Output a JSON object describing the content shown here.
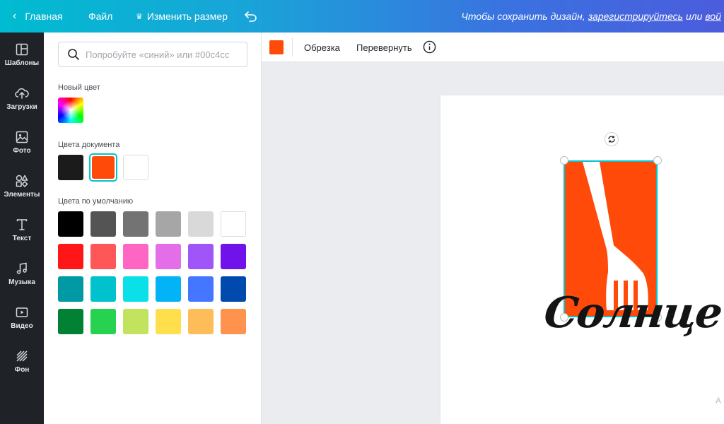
{
  "topbar": {
    "back_label": "Главная",
    "file_label": "Файл",
    "resize_label": "Изменить размер",
    "save_prefix": "Чтобы сохранить дизайн,",
    "save_link_register": "зарегистрируйтесь",
    "save_mid": "или",
    "save_link_login": "вой"
  },
  "rail": {
    "items": [
      {
        "label": "Шаблоны",
        "icon": "templates-icon"
      },
      {
        "label": "Загрузки",
        "icon": "upload-icon"
      },
      {
        "label": "Фото",
        "icon": "photo-icon"
      },
      {
        "label": "Элементы",
        "icon": "elements-icon"
      },
      {
        "label": "Текст",
        "icon": "text-icon"
      },
      {
        "label": "Музыка",
        "icon": "music-icon"
      },
      {
        "label": "Видео",
        "icon": "video-icon"
      },
      {
        "label": "Фон",
        "icon": "background-icon"
      }
    ]
  },
  "panel": {
    "search_placeholder": "Попробуйте «синий» или #00c4cc",
    "new_color_label": "Новый цвет",
    "document_colors_label": "Цвета документа",
    "document_colors": [
      "#1b1b1b",
      "#ff4a0a",
      "#ffffff"
    ],
    "selected_document_color": 1,
    "default_colors_label": "Цвета по умолчанию",
    "default_colors": [
      [
        "#000000",
        "#545454",
        "#737373",
        "#a6a6a6",
        "#d9d9d9",
        "#ffffff"
      ],
      [
        "#ff1616",
        "#ff5757",
        "#ff66c4",
        "#e36ee8",
        "#9f55f7",
        "#7013ea"
      ],
      [
        "#019aa4",
        "#00c2cc",
        "#0ae0e8",
        "#02b3f6",
        "#4576ff",
        "#004aad"
      ],
      [
        "#008133",
        "#26d24f",
        "#c1e35d",
        "#ffdf4c",
        "#ffbd59",
        "#ff924d"
      ]
    ]
  },
  "toolbar": {
    "color": "#ff4a0a",
    "crop_label": "Обрезка",
    "flip_label": "Перевернуть"
  },
  "canvas": {
    "logo_text": "Солнце",
    "logo_bg": "#ff4a0a",
    "selection_color": "#00c4cc"
  }
}
